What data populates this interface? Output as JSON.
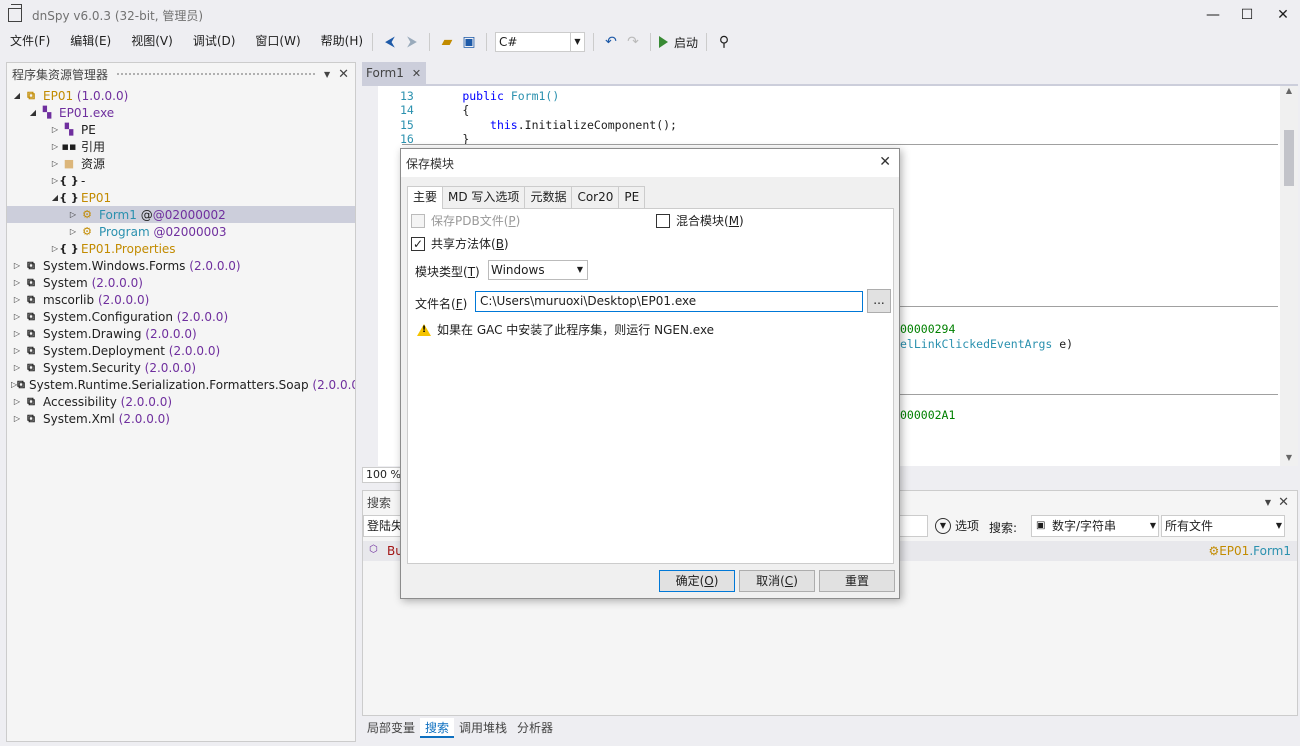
{
  "window": {
    "title": "dnSpy v6.0.3 (32-bit, 管理员)",
    "minimize": "—",
    "maximize": "☐",
    "close": "✕"
  },
  "menu": [
    "文件(F)",
    "编辑(E)",
    "视图(V)",
    "调试(D)",
    "窗口(W)",
    "帮助(H)"
  ],
  "toolbar": {
    "language": "C#",
    "start_label": "启动"
  },
  "assembly_explorer": {
    "title": "程序集资源管理器",
    "items": [
      {
        "name": "EP01",
        "version": "(1.0.0.0)"
      },
      {
        "name": "EP01.exe"
      },
      {
        "name": "PE"
      },
      {
        "name": "引用"
      },
      {
        "name": "资源"
      },
      {
        "name": "-"
      },
      {
        "name": "EP01"
      },
      {
        "name": "Form1",
        "token": "@02000002"
      },
      {
        "name": "Program",
        "token": "@02000003"
      },
      {
        "name": "EP01",
        "suffix": ".Properties"
      },
      {
        "name": "System.Windows.Forms",
        "version": "(2.0.0.0)"
      },
      {
        "name": "System",
        "version": "(2.0.0.0)"
      },
      {
        "name": "mscorlib",
        "version": "(2.0.0.0)"
      },
      {
        "name": "System.Configuration",
        "version": "(2.0.0.0)"
      },
      {
        "name": "System.Drawing",
        "version": "(2.0.0.0)"
      },
      {
        "name": "System.Deployment",
        "version": "(2.0.0.0)"
      },
      {
        "name": "System.Security",
        "version": "(2.0.0.0)"
      },
      {
        "name": "System.Runtime.Serialization.Formatters.Soap",
        "version": "(2.0.0.0"
      },
      {
        "name": "Accessibility",
        "version": "(2.0.0.0)"
      },
      {
        "name": "System.Xml",
        "version": "(2.0.0.0)"
      }
    ]
  },
  "editor": {
    "tab": "Form1",
    "lines": [
      {
        "num": "13",
        "kw": "public",
        "rest": "Form1()"
      },
      {
        "num": "14",
        "text": "{"
      },
      {
        "num": "15",
        "kw": "this",
        "rest": ".InitializeComponent();"
      },
      {
        "num": "16",
        "text": "}"
      }
    ],
    "frag_token1": "00000294",
    "frag_type": "elLinkClickedEventArgs",
    "frag_param": " e)",
    "frag_token2": "000002A1",
    "zoom": "100 %"
  },
  "search_panel": {
    "title": "搜索",
    "query_partial": "登陆失",
    "options_label": "选项",
    "search_label": "搜索:",
    "search_type": "数字/字符串",
    "scope": "所有文件",
    "result_partial": "Bu",
    "result_location_ns": "EP01",
    "result_location_type": ".Form1"
  },
  "bottom_tabs": [
    "局部变量",
    "搜索",
    "调用堆栈",
    "分析器"
  ],
  "dialog": {
    "title": "保存模块",
    "tabs": [
      "主要",
      "MD 写入选项",
      "元数据",
      "Cor20",
      "PE"
    ],
    "save_pdb": "保存PDB文件(",
    "save_pdb_key": "P",
    "mixed_module": "混合模块(",
    "mixed_module_key": "M",
    "share_method_bodies": "共享方法体(",
    "share_method_bodies_key": "B",
    "module_type_label": "模块类型(",
    "module_type_key": "T",
    "module_type_value": "Windows",
    "filename_label": "文件名(",
    "filename_key": "F",
    "filename_value": "C:\\Users\\muruoxi\\Desktop\\EP01.exe",
    "browse": "...",
    "warning": "如果在 GAC 中安装了此程序集，则运行 NGEN.exe",
    "ok": "确定(",
    "ok_key": "O",
    "cancel": "取消(",
    "cancel_key": "C",
    "reset": "重置"
  }
}
